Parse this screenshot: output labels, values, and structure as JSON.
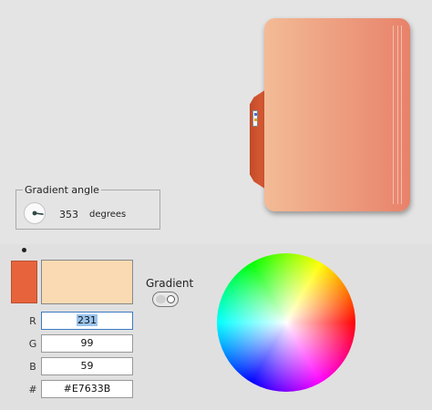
{
  "gradient_angle": {
    "legend": "Gradient angle",
    "value": "353",
    "value_number": 353,
    "unit": "degrees"
  },
  "colors": {
    "current_color": "#E7633B",
    "second_color": "#F9DAB2",
    "folder_gradient_start": "#F3BB96",
    "folder_gradient_end": "#E8826A",
    "tab_color": "#E0603A"
  },
  "gradient": {
    "label": "Gradient",
    "enabled": false
  },
  "fields": {
    "r_label": "R",
    "r_value": "231",
    "g_label": "G",
    "g_value": "99",
    "b_label": "B",
    "b_value": "59",
    "hex_label": "#",
    "hex_value": "#E7633B"
  },
  "icons": {
    "folder": "folder-preview-icon",
    "angle_dial": "angle-dial-icon",
    "color_wheel": "color-wheel-icon",
    "toggle": "toggle-switch-icon"
  }
}
